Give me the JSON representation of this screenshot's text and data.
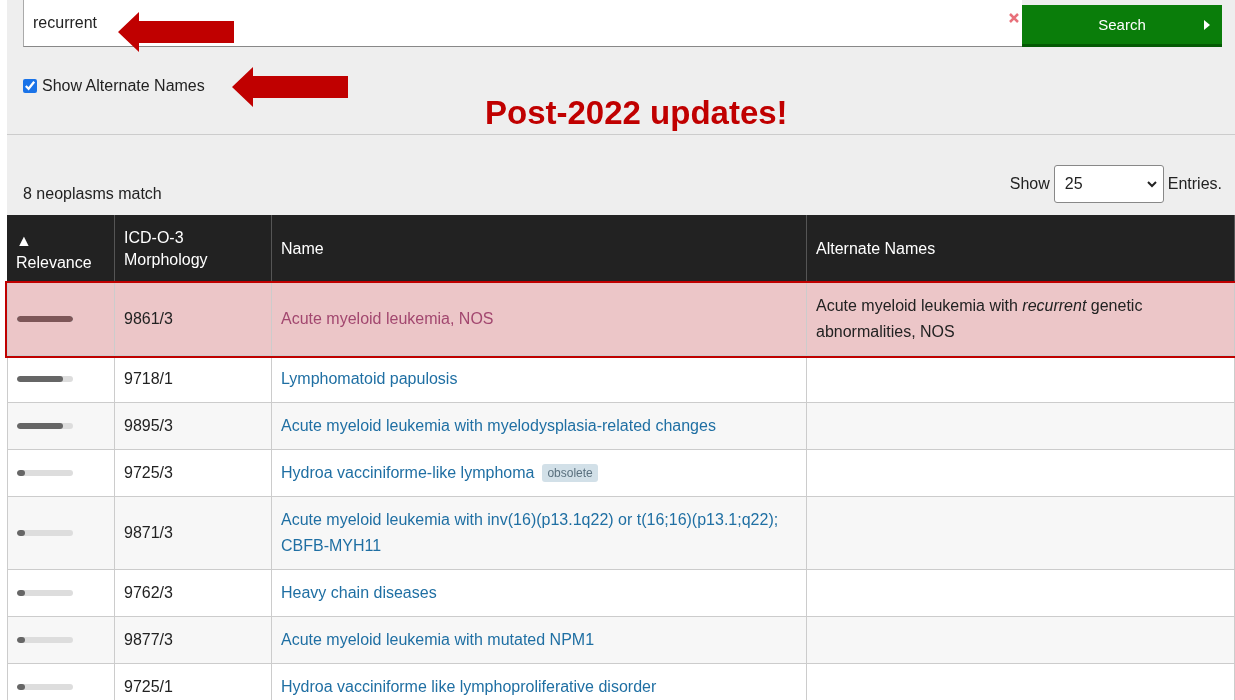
{
  "search": {
    "value": "recurrent",
    "button": "Search"
  },
  "options": {
    "show_alternate_names": {
      "label": "Show Alternate Names",
      "checked": true
    }
  },
  "annotations": [
    {
      "kind": "arrow"
    },
    {
      "kind": "arrow"
    },
    {
      "kind": "text",
      "text": "Post-2022 updates!"
    }
  ],
  "results": {
    "count": "8 neoplasms match",
    "page_size": {
      "label": "Show",
      "value": "25",
      "suffix": "Entries."
    },
    "columns": [
      {
        "label": "Relevance",
        "sort_indicator": "▲"
      },
      {
        "label": "ICD-O-3 Morphology"
      },
      {
        "label": "Name"
      },
      {
        "label": "Alternate Names"
      }
    ],
    "rows": [
      {
        "relevance": {
          "level": 1
        },
        "code": "9861/3",
        "name": "Acute myeloid leukemia, NOS",
        "alternate_names": "Acute myeloid leukemia with *recurrent* genetic abnormalities, NOS",
        "highlighted": true
      },
      {
        "relevance": {
          "level": 0.82
        },
        "code": "9718/1",
        "name": "Lymphomatoid papulosis",
        "highlighted": false
      },
      {
        "relevance": {
          "level": 0.82
        },
        "code": "9895/3",
        "name": "Acute myeloid leukemia with myelodysplasia-related changes",
        "highlighted": false
      },
      {
        "relevance": {
          "level": 0.15
        },
        "code": "9725/3",
        "name": "Hydroa vacciniforme-like lymphoma",
        "tag": "obsolete",
        "highlighted": false
      },
      {
        "relevance": {
          "level": 0.15
        },
        "code": "9871/3",
        "name": "Acute myeloid leukemia with inv(16)(p13.1q22) or t(16;16)(p13.1;q22); CBFB-MYH11",
        "highlighted": false
      },
      {
        "relevance": {
          "level": 0.15
        },
        "code": "9762/3",
        "name": "Heavy chain diseases",
        "highlighted": false
      },
      {
        "relevance": {
          "level": 0.15
        },
        "code": "9877/3",
        "name": "Acute myeloid leukemia with mutated NPM1",
        "highlighted": false
      },
      {
        "relevance": {
          "level": 0.15
        },
        "code": "9725/1",
        "name": "Hydroa vacciniforme like lymphoproliferative disorder",
        "highlighted": false
      }
    ]
  }
}
